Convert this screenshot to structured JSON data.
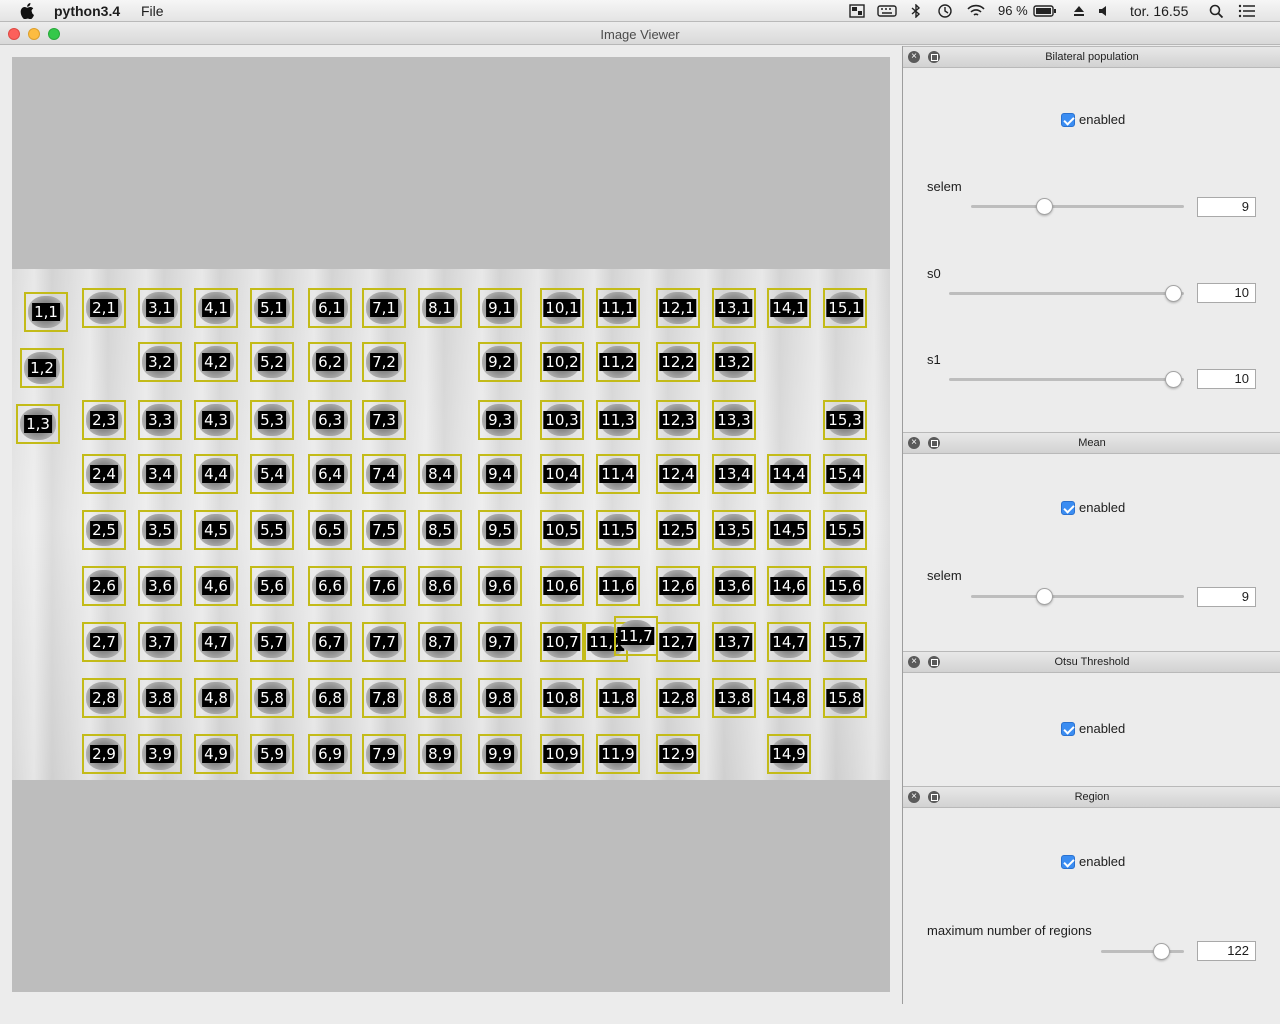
{
  "menubar": {
    "app_name": "python3.4",
    "menu_file": "File",
    "battery": "96 %",
    "clock": "tor. 16.55"
  },
  "window": {
    "title": "Image Viewer"
  },
  "colonies": [
    "1,1",
    "2,1",
    "3,1",
    "4,1",
    "5,1",
    "6,1",
    "7,1",
    "8,1",
    "9,1",
    "10,1",
    "11,1",
    "12,1",
    "13,1",
    "14,1",
    "15,1",
    "1,2",
    "3,2",
    "4,2",
    "5,2",
    "6,2",
    "7,2",
    "9,2",
    "10,2",
    "11,2",
    "12,2",
    "13,2",
    "1,3",
    "2,3",
    "3,3",
    "4,3",
    "5,3",
    "6,3",
    "7,3",
    "9,3",
    "10,3",
    "11,3",
    "12,3",
    "13,3",
    "15,3",
    "2,4",
    "3,4",
    "4,4",
    "5,4",
    "6,4",
    "7,4",
    "8,4",
    "9,4",
    "10,4",
    "11,4",
    "12,4",
    "13,4",
    "14,4",
    "15,4",
    "2,5",
    "3,5",
    "4,5",
    "5,5",
    "6,5",
    "7,5",
    "8,5",
    "9,5",
    "10,5",
    "11,5",
    "12,5",
    "13,5",
    "14,5",
    "15,5",
    "2,6",
    "3,6",
    "4,6",
    "5,6",
    "6,6",
    "7,6",
    "8,6",
    "9,6",
    "10,6",
    "11,6",
    "12,6",
    "13,6",
    "14,6",
    "15,6",
    "2,7",
    "3,7",
    "4,7",
    "5,7",
    "6,7",
    "7,7",
    "8,7",
    "9,7",
    "10,7",
    "11,7",
    "11,7",
    "12,7",
    "13,7",
    "14,7",
    "15,7",
    "2,8",
    "3,8",
    "4,8",
    "5,8",
    "6,8",
    "7,8",
    "8,8",
    "9,8",
    "10,8",
    "11,8",
    "12,8",
    "13,8",
    "14,8",
    "15,8",
    "2,9",
    "3,9",
    "4,9",
    "5,9",
    "6,9",
    "7,9",
    "8,9",
    "9,9",
    "10,9",
    "11,9",
    "12,9",
    "14,9"
  ],
  "panels": {
    "bilateral": {
      "title": "Bilateral population",
      "enabled_label": "enabled",
      "selem_label": "selem",
      "selem_value": "9",
      "s0_label": "s0",
      "s0_value": "10",
      "s1_label": "s1",
      "s1_value": "10"
    },
    "mean": {
      "title": "Mean",
      "enabled_label": "enabled",
      "selem_label": "selem",
      "selem_value": "9"
    },
    "otsu": {
      "title": "Otsu Threshold",
      "enabled_label": "enabled"
    },
    "region": {
      "title": "Region",
      "enabled_label": "enabled",
      "max_regions_label": "maximum number of regions",
      "max_regions_value": "122"
    }
  },
  "colors": {
    "accent": "#3b8df2",
    "box": "#c3bb19"
  }
}
